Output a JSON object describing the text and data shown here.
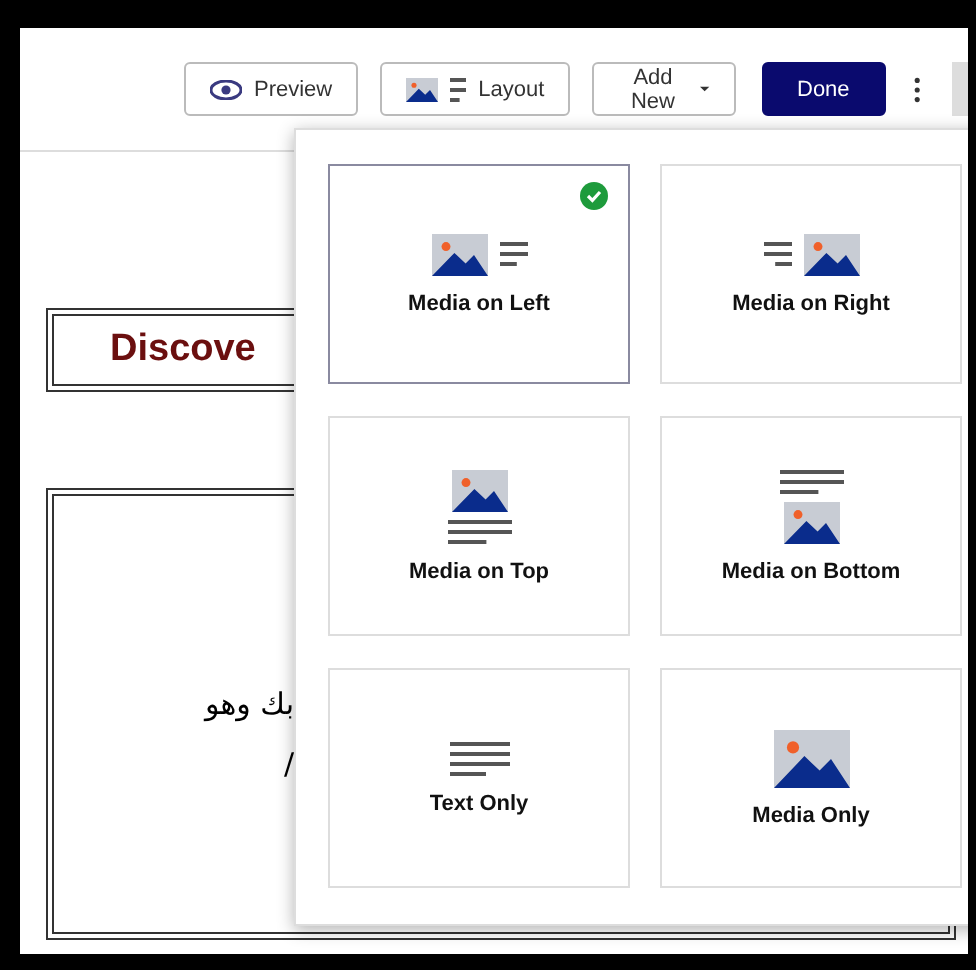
{
  "toolbar": {
    "buttons": [
      {
        "label": "Preview",
        "kind": "preview"
      },
      {
        "label": "Layout",
        "kind": "layout"
      },
      {
        "label": "Add New",
        "kind": "dropdown"
      },
      {
        "label": "Done",
        "kind": "primary"
      }
    ]
  },
  "content": {
    "heading": "Discove",
    "body_lines": [
      "بك وهو",
      "/"
    ]
  },
  "layout_menu": {
    "options": [
      {
        "label": "Media on Left",
        "kind": "left",
        "selected": true
      },
      {
        "label": "Media on Right",
        "kind": "right",
        "selected": false
      },
      {
        "label": "Media on Top",
        "kind": "top",
        "selected": false
      },
      {
        "label": "Media on Bottom",
        "kind": "bottom",
        "selected": false
      },
      {
        "label": "Text Only",
        "kind": "text",
        "selected": false
      },
      {
        "label": "Media Only",
        "kind": "media",
        "selected": false
      }
    ]
  }
}
